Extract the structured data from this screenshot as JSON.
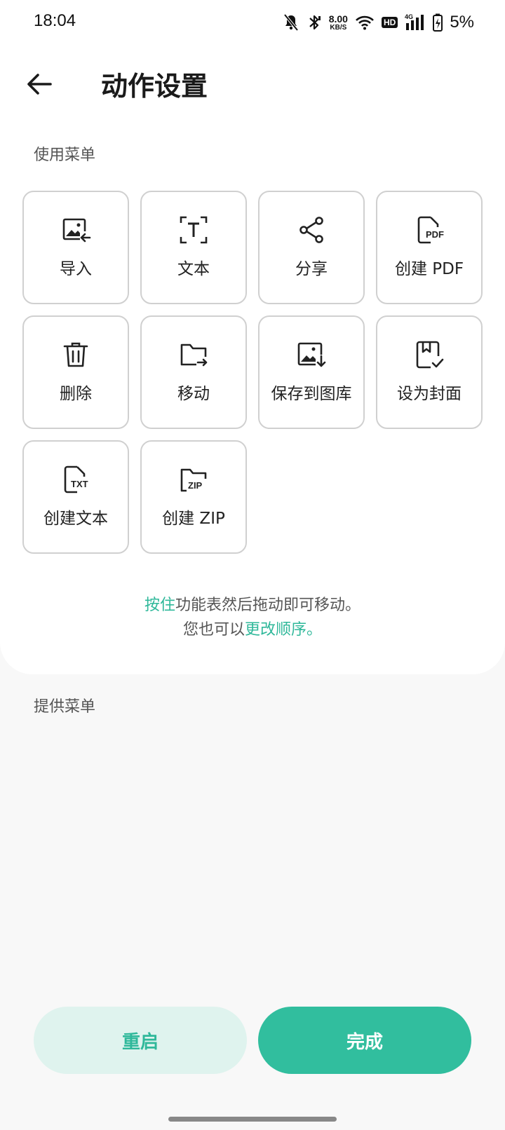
{
  "status_bar": {
    "time": "18:04",
    "net_speed_value": "8.00",
    "net_speed_unit": "KB/S",
    "hd_label": "HD",
    "network_type": "4G",
    "battery_percent": "5%"
  },
  "header": {
    "title": "动作设置"
  },
  "used_menu": {
    "label": "使用菜单",
    "items": [
      {
        "label": "导入",
        "icon": "image-import-icon"
      },
      {
        "label": "文本",
        "icon": "text-scan-icon"
      },
      {
        "label": "分享",
        "icon": "share-icon"
      },
      {
        "label": "创建 PDF",
        "icon": "pdf-file-icon"
      },
      {
        "label": "删除",
        "icon": "trash-icon"
      },
      {
        "label": "移动",
        "icon": "folder-move-icon"
      },
      {
        "label": "保存到图库",
        "icon": "save-to-gallery-icon"
      },
      {
        "label": "设为封面",
        "icon": "set-cover-icon"
      },
      {
        "label": "创建文本",
        "icon": "txt-file-icon"
      },
      {
        "label": "创建 ZIP",
        "icon": "zip-folder-icon"
      }
    ]
  },
  "hint": {
    "line1_accent": "按住",
    "line1_rest": "功能表然后拖动即可移动。",
    "line2_prefix": "您也可以",
    "line2_accent": "更改顺序。"
  },
  "offered_menu": {
    "label": "提供菜单"
  },
  "buttons": {
    "reset_label": "重启",
    "done_label": "完成"
  },
  "colors": {
    "accent": "#31be9e",
    "accent_light": "#dff3ee"
  }
}
